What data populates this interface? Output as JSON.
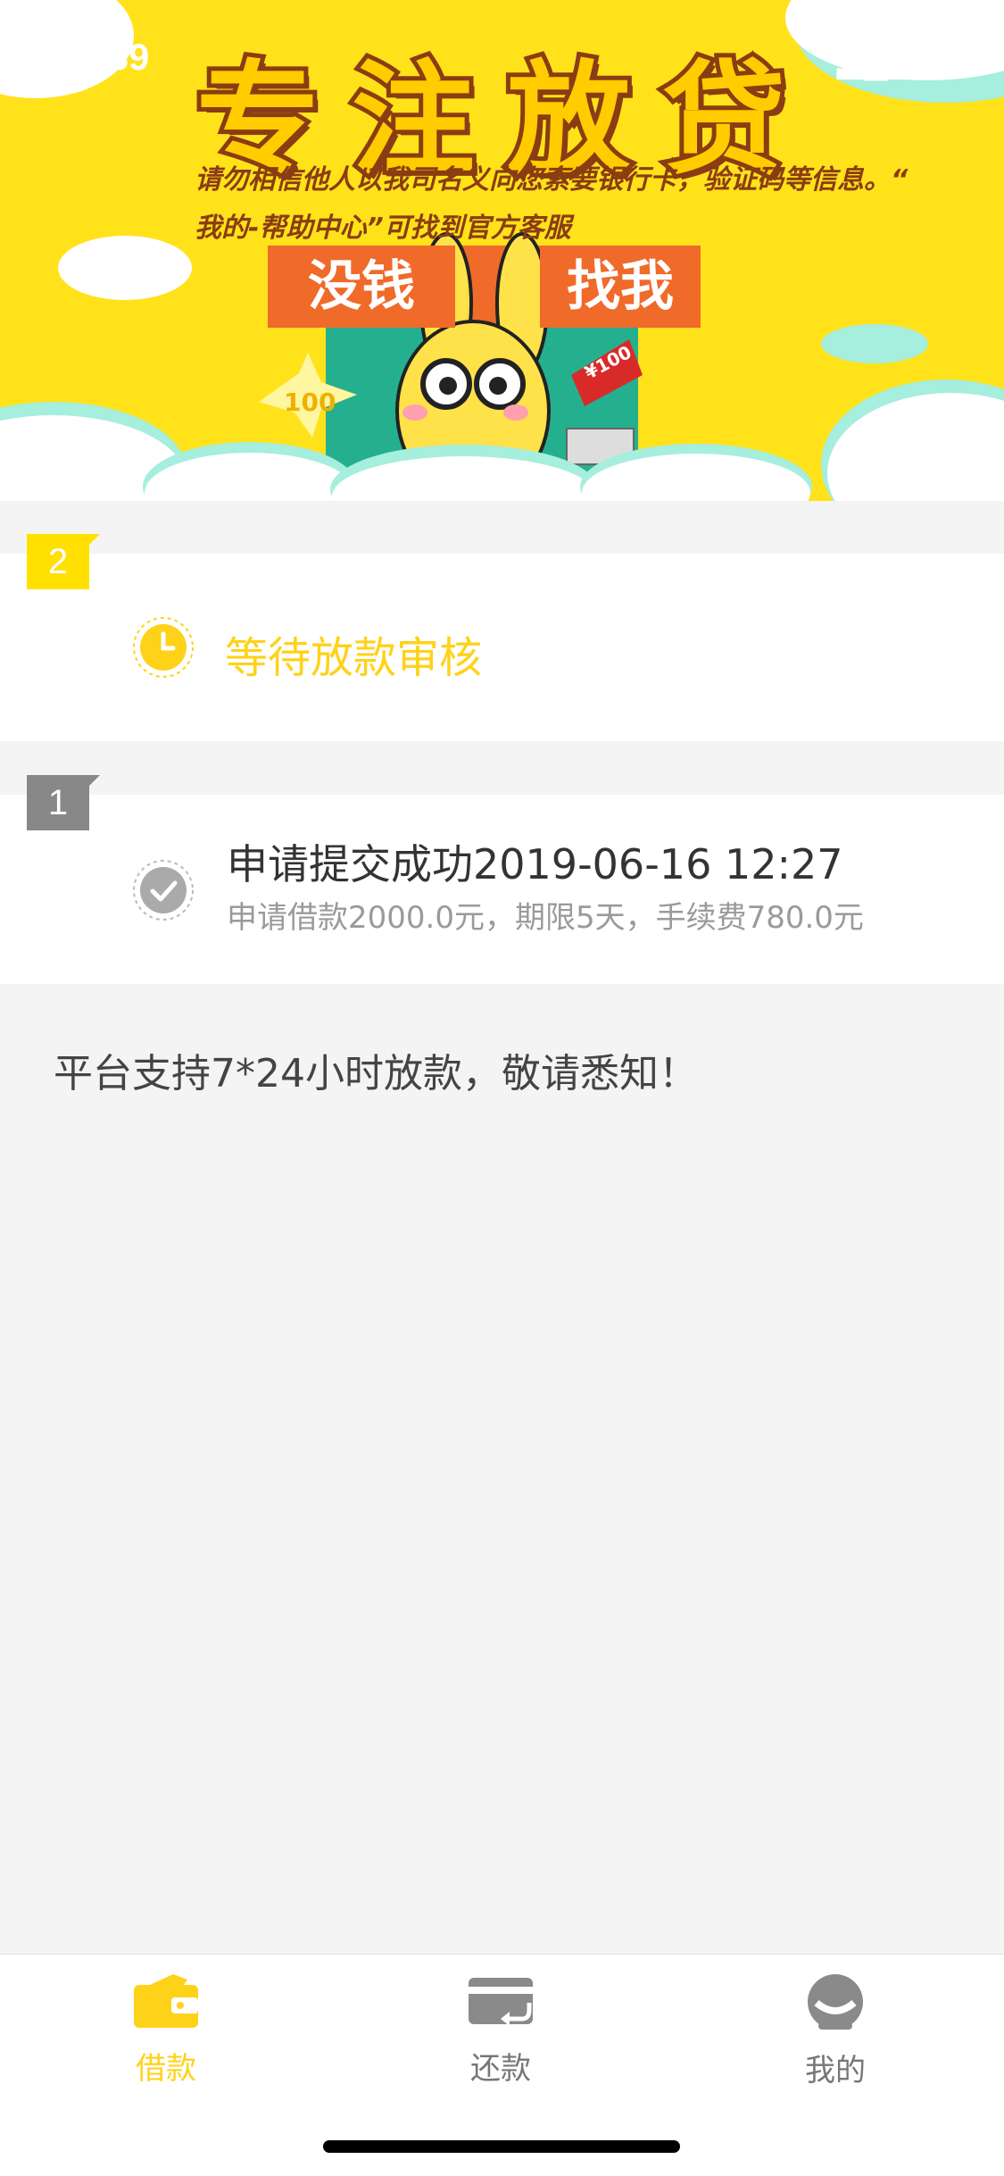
{
  "status_bar": {
    "time": "12:39",
    "network": "4G"
  },
  "banner": {
    "title": "专注放贷",
    "notice_line1": "请勿相信他人以我司名义向您索要银行卡，验证码等信息。“",
    "notice_line2": "我的-帮助中心”可找到官方客服",
    "sign_left": "没钱",
    "sign_right": "找我",
    "coin_left": "100",
    "coin_right": "¥100"
  },
  "steps": [
    {
      "number": "2",
      "status": "等待放款审核"
    },
    {
      "number": "1",
      "title": "申请提交成功2019-06-16 12:27",
      "detail": "申请借款2000.0元，期限5天，手续费780.0元"
    }
  ],
  "notice": "平台支持7*24小时放款，敬请悉知！",
  "tabbar": {
    "loan": "借款",
    "repay": "还款",
    "mine": "我的"
  },
  "colors": {
    "accent": "#ffd21a",
    "banner_bg": "#ffe21a",
    "muted": "#888888"
  }
}
